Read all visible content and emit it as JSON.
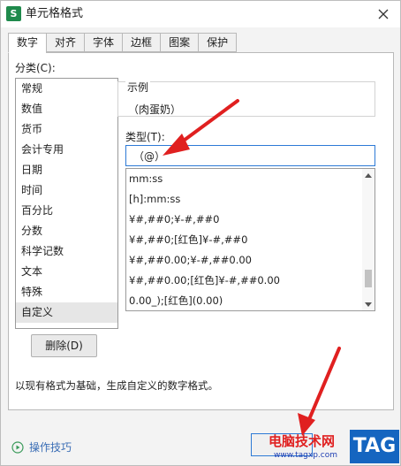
{
  "window": {
    "app_icon_letter": "S",
    "title": "单元格格式"
  },
  "tabs": [
    {
      "label": "数字",
      "active": true
    },
    {
      "label": "对齐"
    },
    {
      "label": "字体"
    },
    {
      "label": "边框"
    },
    {
      "label": "图案"
    },
    {
      "label": "保护"
    }
  ],
  "category": {
    "label": "分类(C):",
    "items": [
      "常规",
      "数值",
      "货币",
      "会计专用",
      "日期",
      "时间",
      "百分比",
      "分数",
      "科学记数",
      "文本",
      "特殊",
      "自定义"
    ],
    "selected": "自定义"
  },
  "sample": {
    "label": "示例",
    "value": "（肉蛋奶）"
  },
  "type": {
    "label": "类型(T):",
    "value": "（@）"
  },
  "formats": [
    "mm:ss",
    "[h]:mm:ss",
    "¥#,##0;¥-#,##0",
    "¥#,##0;[红色]¥-#,##0",
    "¥#,##0.00;¥-#,##0.00",
    "¥#,##0.00;[红色]¥-#,##0.00",
    "0.00_);[红色](0.00)"
  ],
  "delete_button": "删除(D)",
  "description": "以现有格式为基础，生成自定义的数字格式。",
  "tips_label": "操作技巧",
  "watermark": {
    "text": "电脑技术网",
    "url": "www.tagxp.com",
    "tag": "TAG"
  },
  "colors": {
    "accent": "#2d7ad6",
    "arrow": "#e02020",
    "app_icon": "#1f8a4c",
    "tag_bg": "#1565c0"
  }
}
